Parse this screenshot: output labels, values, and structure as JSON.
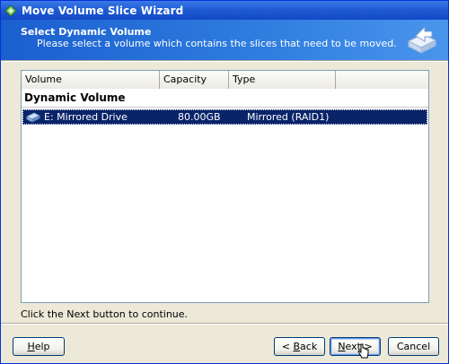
{
  "window": {
    "title": "Move Volume Slice Wizard",
    "icon": "wizard-app-icon"
  },
  "header": {
    "title": "Select Dynamic Volume",
    "subtitle": "Please select a volume which contains the slices that need to be moved.",
    "icon": "move-volume-icon"
  },
  "list": {
    "columns": [
      "Volume",
      "Capacity",
      "Type",
      ""
    ],
    "group_label": "Dynamic Volume",
    "rows": [
      {
        "volume": "E: Mirrored Drive",
        "capacity": "80.00GB",
        "type": "Mirrored (RAID1)",
        "icon": "drive-icon",
        "selected": true
      }
    ]
  },
  "hint": "Click the Next button to continue.",
  "buttons": {
    "help_pre": "",
    "help_ul": "H",
    "help_post": "elp",
    "back_pre": "< ",
    "back_ul": "B",
    "back_post": "ack",
    "next_pre": "",
    "next_ul": "N",
    "next_post": "ext >",
    "cancel": "Cancel"
  },
  "colors": {
    "selection": "#0a246a",
    "header_start": "#1b5fcf",
    "titlebar": "#1d5ad3"
  }
}
